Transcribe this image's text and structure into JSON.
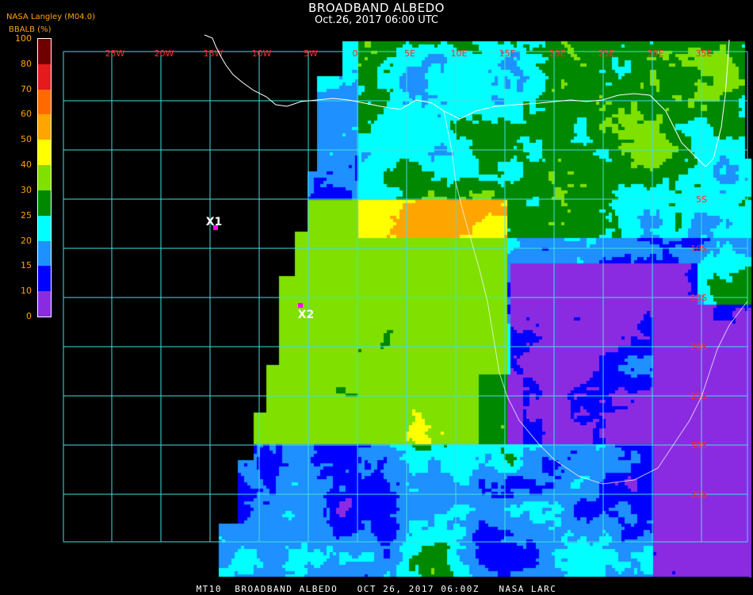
{
  "header": {
    "title": "BROADBAND ALBEDO",
    "subtitle": "Oct.26, 2017 06:00 UTC",
    "organization": "NASA Langley (M04.0)"
  },
  "colorbar": {
    "label": "BBALB (%)",
    "bins": [
      {
        "max": 100,
        "color": "#6e0000"
      },
      {
        "max": 80,
        "color": "#e41a1c"
      },
      {
        "max": 70,
        "color": "#ff6a00"
      },
      {
        "max": 60,
        "color": "#ffa500"
      },
      {
        "max": 50,
        "color": "#ffff00"
      },
      {
        "max": 40,
        "color": "#80e000"
      },
      {
        "max": 30,
        "color": "#008800"
      },
      {
        "max": 25,
        "color": "#00ffff"
      },
      {
        "max": 20,
        "color": "#1e90ff"
      },
      {
        "max": 15,
        "color": "#0000ff"
      },
      {
        "max": 10,
        "color": "#8a2be2"
      }
    ],
    "ticks": [
      "100",
      "80",
      "70",
      "60",
      "50",
      "40",
      "30",
      "25",
      "20",
      "15",
      "10",
      "0"
    ]
  },
  "map": {
    "longitude_labels": [
      "25W",
      "20W",
      "15W",
      "10W",
      "5W",
      "0",
      "5E",
      "10E",
      "15E",
      "20E",
      "25E",
      "30E",
      "35E"
    ],
    "latitude_labels": [
      "5S",
      "10S",
      "15S",
      "20S",
      "25S",
      "30S",
      "35S"
    ],
    "markers": [
      {
        "label": "X1",
        "color": "#ff00ff"
      },
      {
        "label": "X2",
        "color": "#ff00ff"
      }
    ],
    "grid_color": "#40e0e0",
    "coast_color": "#ffffff"
  },
  "footer": {
    "text": "MT10  BROADBAND ALBEDO   OCT 26, 2017 06:00Z   NASA LARC"
  }
}
